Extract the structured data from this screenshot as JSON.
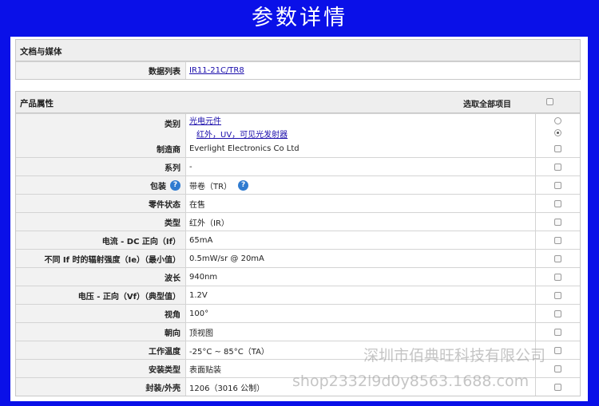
{
  "banner": {
    "title": "参数详情"
  },
  "docs": {
    "title": "文档与媒体",
    "datasheet_label": "数据列表",
    "datasheet_link": "IR11-21C/TR8"
  },
  "attrs": {
    "title": "产品属性",
    "select_all": "选取全部项目",
    "category": {
      "label": "类别",
      "link1": "光电元件",
      "link2": "红外，UV，可见光发射器",
      "selected_index": 1
    },
    "rows": [
      {
        "label": "制造商",
        "value": "Everlight Electronics Co Ltd"
      },
      {
        "label": "系列",
        "value": "-"
      },
      {
        "label": "包装",
        "value": "带卷（TR）",
        "help": true
      },
      {
        "label": "零件状态",
        "value": "在售"
      },
      {
        "label": "类型",
        "value": "红外（IR）"
      },
      {
        "label": "电流 - DC 正向（If）",
        "value": "65mA"
      },
      {
        "label": "不同 If 时的辐射强度（Ie）（最小值）",
        "value": "0.5mW/sr @ 20mA"
      },
      {
        "label": "波长",
        "value": "940nm"
      },
      {
        "label": "电压 - 正向（Vf）（典型值）",
        "value": "1.2V"
      },
      {
        "label": "视角",
        "value": "100°"
      },
      {
        "label": "朝向",
        "value": "顶视图"
      },
      {
        "label": "工作温度",
        "value": "-25°C ~ 85°C（TA）"
      },
      {
        "label": "安装类型",
        "value": "表面贴装"
      },
      {
        "label": "封装/外壳",
        "value": "1206（3016 公制）"
      }
    ]
  },
  "watermarks": {
    "company": "深圳市佰典旺科技有限公司",
    "shop": "shop2332l9d0y8563.1688.com"
  },
  "icons": {
    "help": "help-question-icon"
  },
  "colors": {
    "banner_bg": "#0a10e8",
    "link": "#1a0dab",
    "help_icon": "#2f7bd0"
  }
}
